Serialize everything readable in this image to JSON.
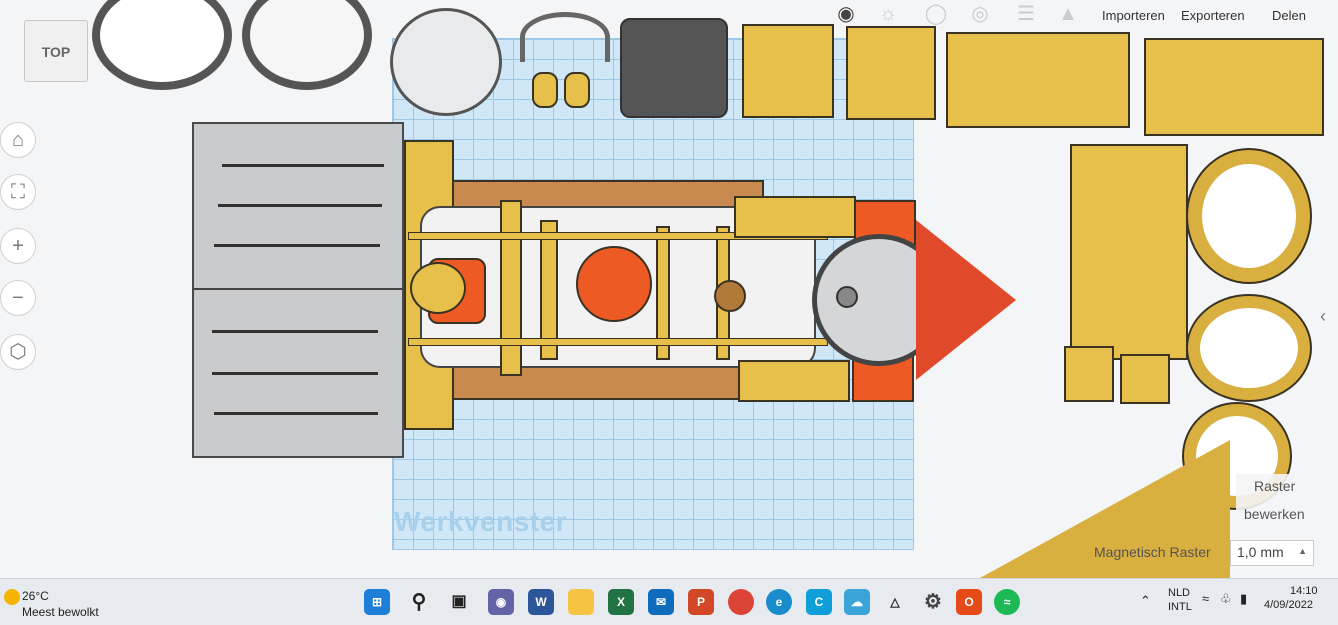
{
  "toolbar": {
    "import_label": "Importeren",
    "export_label": "Exporteren",
    "share_label": "Delen"
  },
  "view_cube": {
    "face_label": "TOP"
  },
  "workplane": {
    "label": "Werkvenster"
  },
  "grid_panel": {
    "title": "Raster",
    "edit_label": "bewerken",
    "snap_label": "Magnetisch Raster",
    "snap_value": "1,0 mm"
  },
  "taskbar": {
    "weather": {
      "temp": "26°C",
      "desc": "Meest bewolkt"
    },
    "language": {
      "code": "NLD",
      "layout": "INTL"
    },
    "clock": {
      "time": "14:10",
      "date": "4/09/2022"
    }
  },
  "colors": {
    "workplane": "#cfe7f7",
    "part_gold": "#e6c04a",
    "part_brown": "#c98a4f",
    "part_red": "#ee5a24",
    "part_grey": "#c9cbcd"
  }
}
